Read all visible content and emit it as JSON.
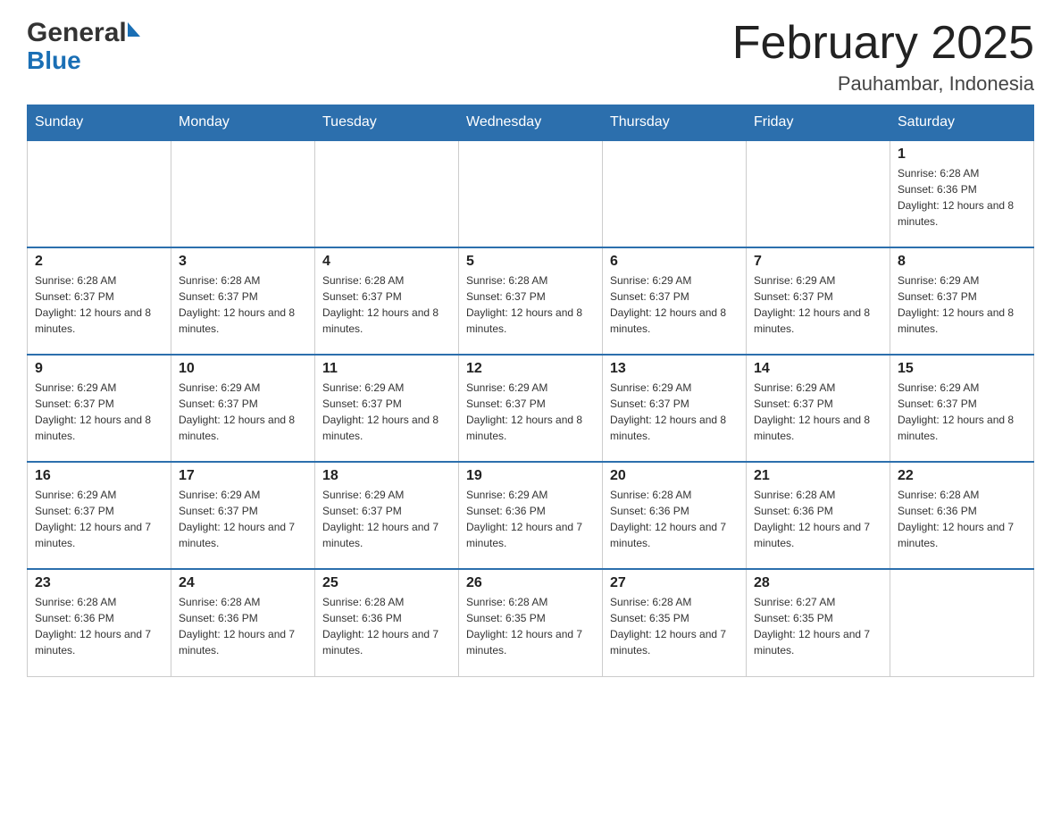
{
  "header": {
    "logo_general": "General",
    "logo_blue": "Blue",
    "month_title": "February 2025",
    "location": "Pauhambar, Indonesia"
  },
  "weekdays": [
    "Sunday",
    "Monday",
    "Tuesday",
    "Wednesday",
    "Thursday",
    "Friday",
    "Saturday"
  ],
  "weeks": [
    [
      {
        "day": "",
        "sunrise": "",
        "sunset": "",
        "daylight": ""
      },
      {
        "day": "",
        "sunrise": "",
        "sunset": "",
        "daylight": ""
      },
      {
        "day": "",
        "sunrise": "",
        "sunset": "",
        "daylight": ""
      },
      {
        "day": "",
        "sunrise": "",
        "sunset": "",
        "daylight": ""
      },
      {
        "day": "",
        "sunrise": "",
        "sunset": "",
        "daylight": ""
      },
      {
        "day": "",
        "sunrise": "",
        "sunset": "",
        "daylight": ""
      },
      {
        "day": "1",
        "sunrise": "Sunrise: 6:28 AM",
        "sunset": "Sunset: 6:36 PM",
        "daylight": "Daylight: 12 hours and 8 minutes."
      }
    ],
    [
      {
        "day": "2",
        "sunrise": "Sunrise: 6:28 AM",
        "sunset": "Sunset: 6:37 PM",
        "daylight": "Daylight: 12 hours and 8 minutes."
      },
      {
        "day": "3",
        "sunrise": "Sunrise: 6:28 AM",
        "sunset": "Sunset: 6:37 PM",
        "daylight": "Daylight: 12 hours and 8 minutes."
      },
      {
        "day": "4",
        "sunrise": "Sunrise: 6:28 AM",
        "sunset": "Sunset: 6:37 PM",
        "daylight": "Daylight: 12 hours and 8 minutes."
      },
      {
        "day": "5",
        "sunrise": "Sunrise: 6:28 AM",
        "sunset": "Sunset: 6:37 PM",
        "daylight": "Daylight: 12 hours and 8 minutes."
      },
      {
        "day": "6",
        "sunrise": "Sunrise: 6:29 AM",
        "sunset": "Sunset: 6:37 PM",
        "daylight": "Daylight: 12 hours and 8 minutes."
      },
      {
        "day": "7",
        "sunrise": "Sunrise: 6:29 AM",
        "sunset": "Sunset: 6:37 PM",
        "daylight": "Daylight: 12 hours and 8 minutes."
      },
      {
        "day": "8",
        "sunrise": "Sunrise: 6:29 AM",
        "sunset": "Sunset: 6:37 PM",
        "daylight": "Daylight: 12 hours and 8 minutes."
      }
    ],
    [
      {
        "day": "9",
        "sunrise": "Sunrise: 6:29 AM",
        "sunset": "Sunset: 6:37 PM",
        "daylight": "Daylight: 12 hours and 8 minutes."
      },
      {
        "day": "10",
        "sunrise": "Sunrise: 6:29 AM",
        "sunset": "Sunset: 6:37 PM",
        "daylight": "Daylight: 12 hours and 8 minutes."
      },
      {
        "day": "11",
        "sunrise": "Sunrise: 6:29 AM",
        "sunset": "Sunset: 6:37 PM",
        "daylight": "Daylight: 12 hours and 8 minutes."
      },
      {
        "day": "12",
        "sunrise": "Sunrise: 6:29 AM",
        "sunset": "Sunset: 6:37 PM",
        "daylight": "Daylight: 12 hours and 8 minutes."
      },
      {
        "day": "13",
        "sunrise": "Sunrise: 6:29 AM",
        "sunset": "Sunset: 6:37 PM",
        "daylight": "Daylight: 12 hours and 8 minutes."
      },
      {
        "day": "14",
        "sunrise": "Sunrise: 6:29 AM",
        "sunset": "Sunset: 6:37 PM",
        "daylight": "Daylight: 12 hours and 8 minutes."
      },
      {
        "day": "15",
        "sunrise": "Sunrise: 6:29 AM",
        "sunset": "Sunset: 6:37 PM",
        "daylight": "Daylight: 12 hours and 8 minutes."
      }
    ],
    [
      {
        "day": "16",
        "sunrise": "Sunrise: 6:29 AM",
        "sunset": "Sunset: 6:37 PM",
        "daylight": "Daylight: 12 hours and 7 minutes."
      },
      {
        "day": "17",
        "sunrise": "Sunrise: 6:29 AM",
        "sunset": "Sunset: 6:37 PM",
        "daylight": "Daylight: 12 hours and 7 minutes."
      },
      {
        "day": "18",
        "sunrise": "Sunrise: 6:29 AM",
        "sunset": "Sunset: 6:37 PM",
        "daylight": "Daylight: 12 hours and 7 minutes."
      },
      {
        "day": "19",
        "sunrise": "Sunrise: 6:29 AM",
        "sunset": "Sunset: 6:36 PM",
        "daylight": "Daylight: 12 hours and 7 minutes."
      },
      {
        "day": "20",
        "sunrise": "Sunrise: 6:28 AM",
        "sunset": "Sunset: 6:36 PM",
        "daylight": "Daylight: 12 hours and 7 minutes."
      },
      {
        "day": "21",
        "sunrise": "Sunrise: 6:28 AM",
        "sunset": "Sunset: 6:36 PM",
        "daylight": "Daylight: 12 hours and 7 minutes."
      },
      {
        "day": "22",
        "sunrise": "Sunrise: 6:28 AM",
        "sunset": "Sunset: 6:36 PM",
        "daylight": "Daylight: 12 hours and 7 minutes."
      }
    ],
    [
      {
        "day": "23",
        "sunrise": "Sunrise: 6:28 AM",
        "sunset": "Sunset: 6:36 PM",
        "daylight": "Daylight: 12 hours and 7 minutes."
      },
      {
        "day": "24",
        "sunrise": "Sunrise: 6:28 AM",
        "sunset": "Sunset: 6:36 PM",
        "daylight": "Daylight: 12 hours and 7 minutes."
      },
      {
        "day": "25",
        "sunrise": "Sunrise: 6:28 AM",
        "sunset": "Sunset: 6:36 PM",
        "daylight": "Daylight: 12 hours and 7 minutes."
      },
      {
        "day": "26",
        "sunrise": "Sunrise: 6:28 AM",
        "sunset": "Sunset: 6:35 PM",
        "daylight": "Daylight: 12 hours and 7 minutes."
      },
      {
        "day": "27",
        "sunrise": "Sunrise: 6:28 AM",
        "sunset": "Sunset: 6:35 PM",
        "daylight": "Daylight: 12 hours and 7 minutes."
      },
      {
        "day": "28",
        "sunrise": "Sunrise: 6:27 AM",
        "sunset": "Sunset: 6:35 PM",
        "daylight": "Daylight: 12 hours and 7 minutes."
      },
      {
        "day": "",
        "sunrise": "",
        "sunset": "",
        "daylight": ""
      }
    ]
  ]
}
